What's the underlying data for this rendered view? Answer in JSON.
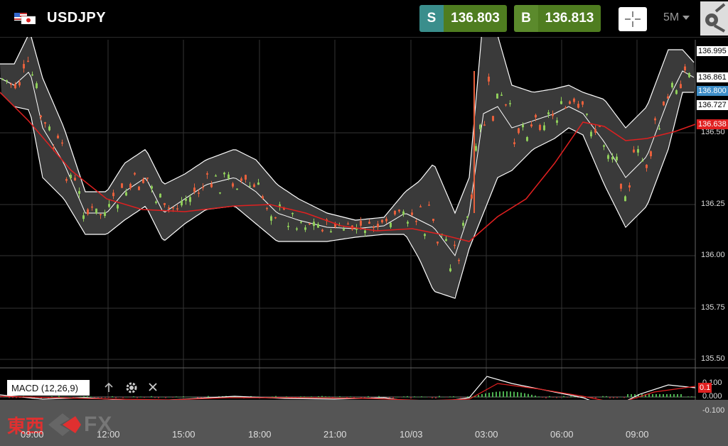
{
  "header": {
    "symbol": "USDJPY",
    "sell": {
      "tag": "S",
      "price": "136.803"
    },
    "buy": {
      "tag": "B",
      "price": "136.813"
    },
    "timeframe": "5M"
  },
  "price_axis": {
    "ticks": [
      "136.50",
      "136.25",
      "136.00",
      "135.75",
      "135.50"
    ],
    "tags": [
      {
        "label": "136.995",
        "color": "#ffffff",
        "text": "#000000"
      },
      {
        "label": "136.861",
        "color": "#ffffff",
        "text": "#000000"
      },
      {
        "label": "136.800",
        "color": "#3e8ec8",
        "text": "#ffffff"
      },
      {
        "label": "136.727",
        "color": "#ffffff",
        "text": "#000000"
      },
      {
        "label": "136.638",
        "color": "#e02020",
        "text": "#ffffff"
      }
    ]
  },
  "macd": {
    "label": "MACD (12,26,9)",
    "axis": [
      "0.100",
      "0.000",
      "-0.100"
    ],
    "value_tag": "0.1"
  },
  "time_axis": [
    "09:00",
    "12:00",
    "15:00",
    "18:00",
    "21:00",
    "10/03",
    "03:00",
    "06:00",
    "09:00"
  ],
  "brand": {
    "kanji": "東西",
    "fx": "FX"
  },
  "colors": {
    "sell": "#3a8e8c",
    "buy": "#5b8a2c",
    "ma": "#e02020",
    "band_fill": "#3a3a3a",
    "up": "#8fce5a",
    "down": "#e8603c"
  }
}
